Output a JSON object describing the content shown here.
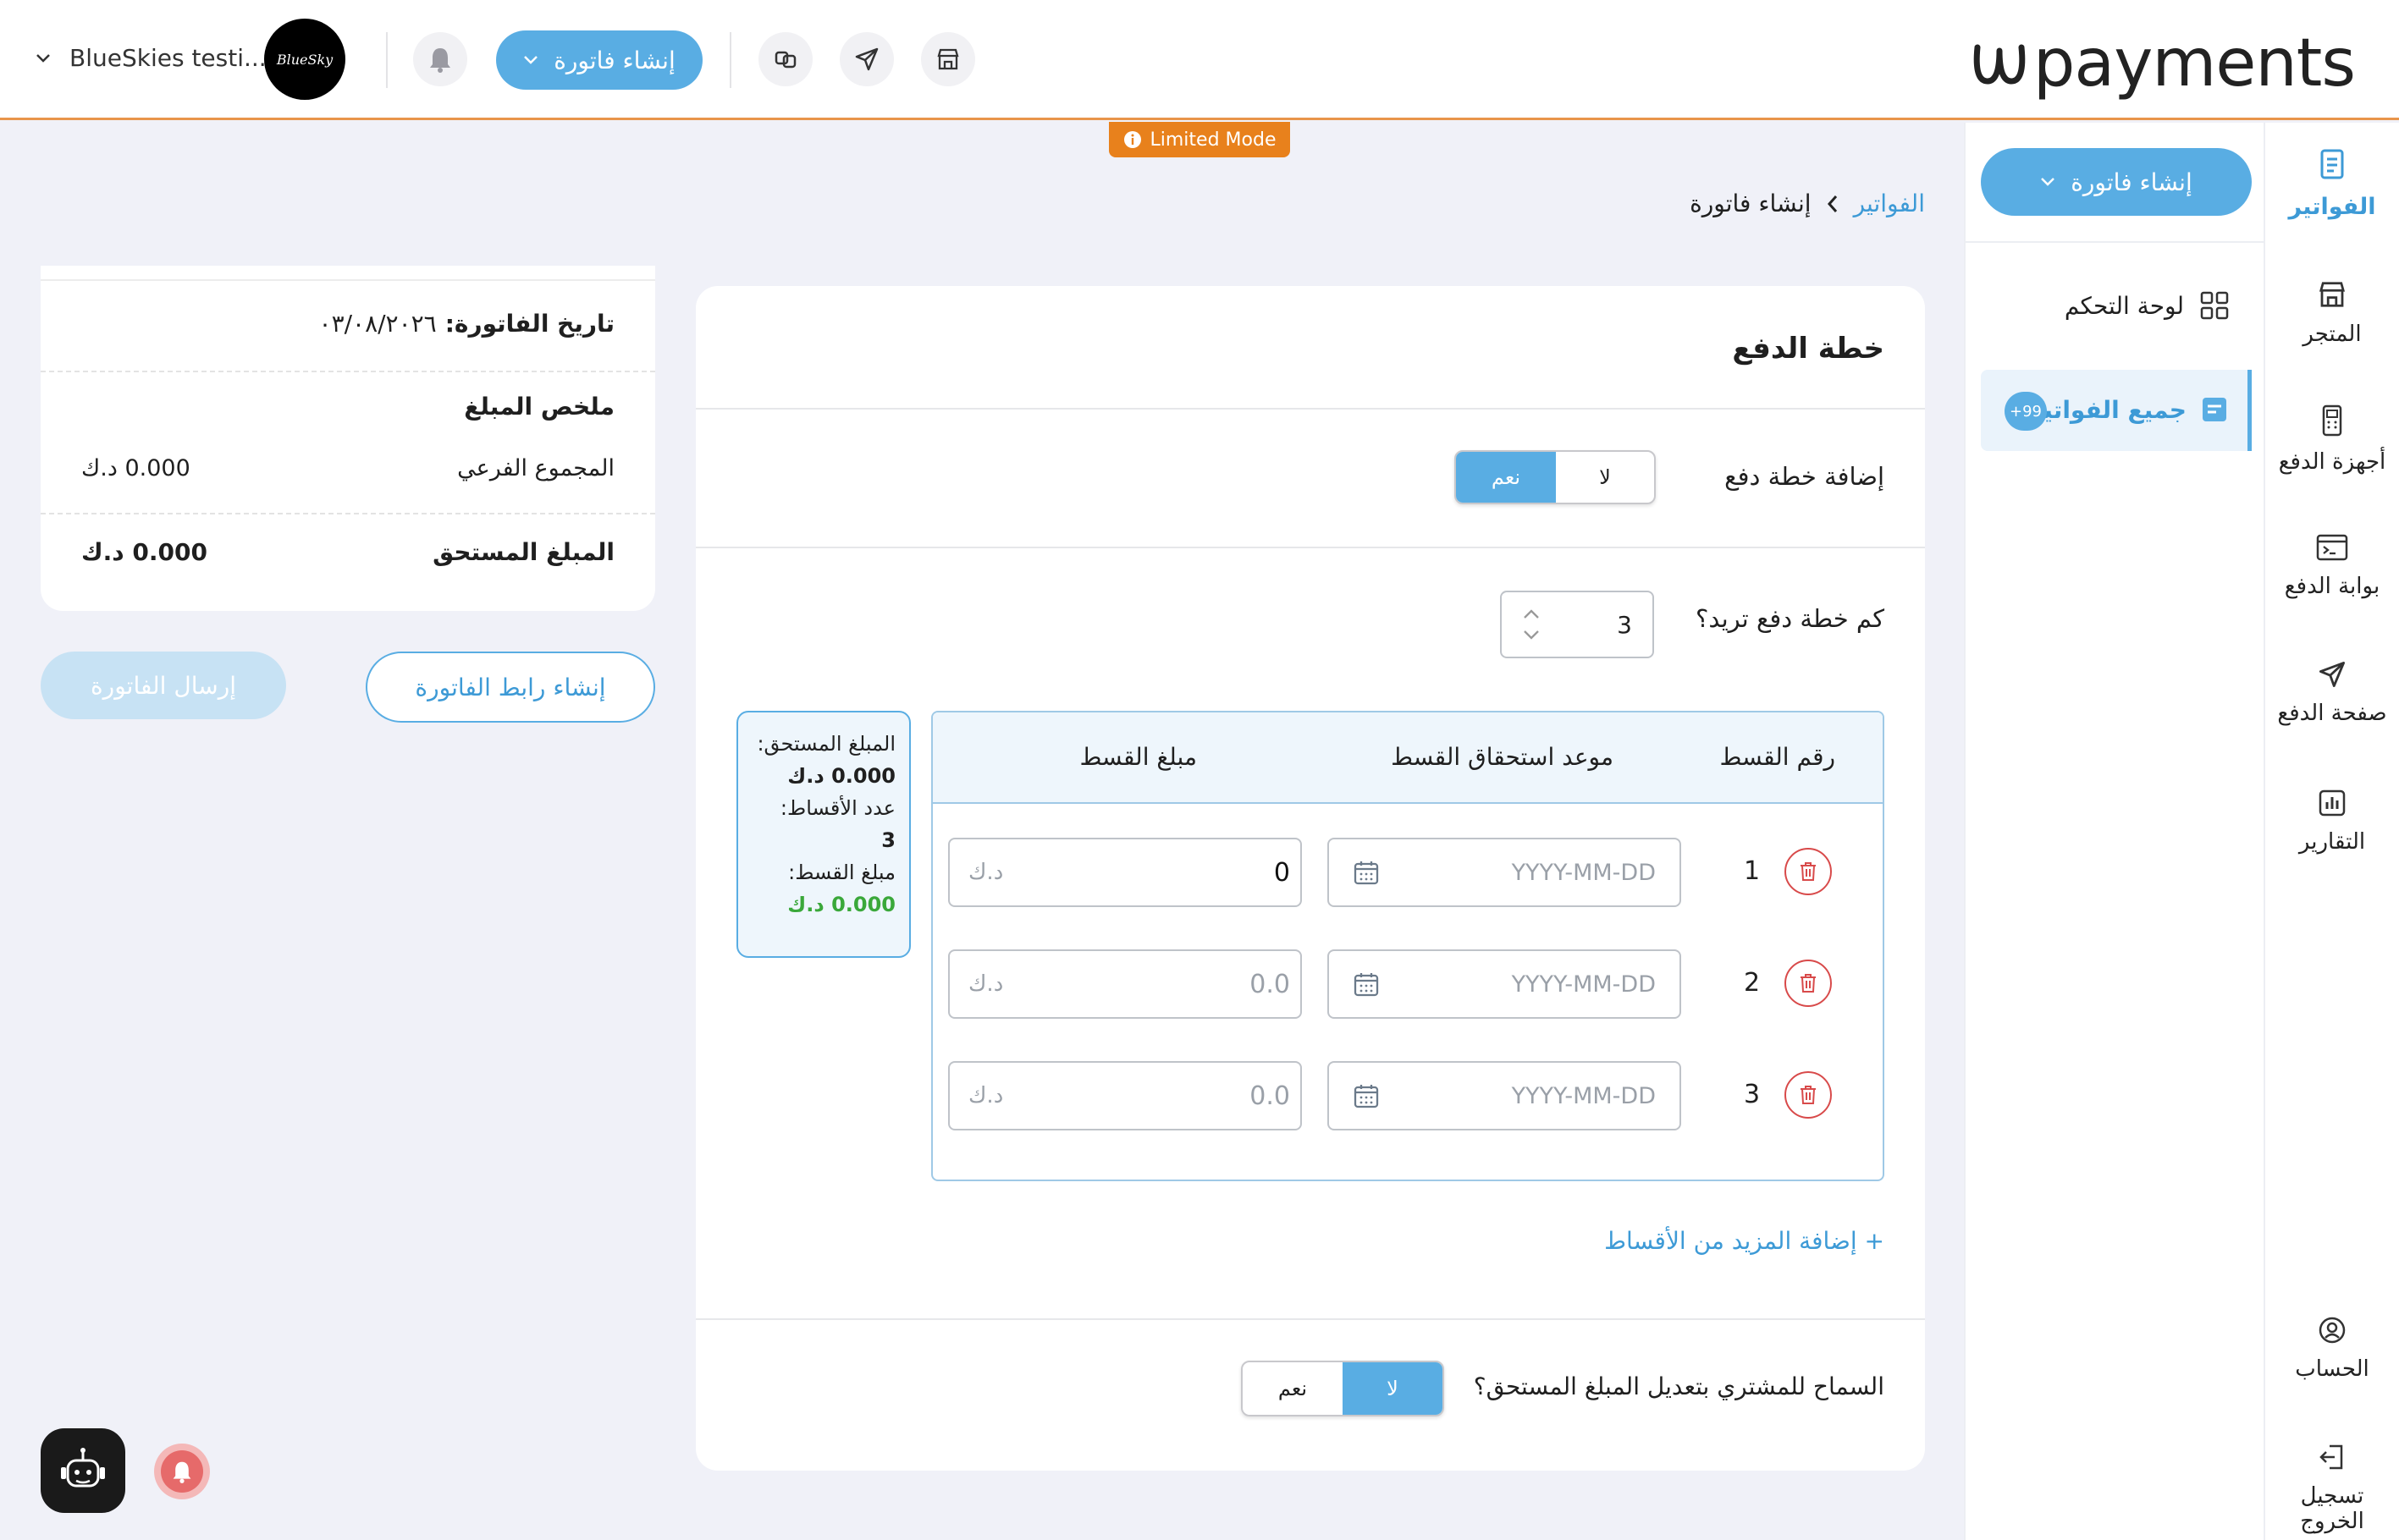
{
  "header": {
    "logo_text": "payments",
    "account_name": "BlueSkies testi...",
    "avatar_text": "BlueSky",
    "create_invoice_btn": "إنشاء فاتورة"
  },
  "limited_mode": "Limited Mode",
  "rail": {
    "items": [
      {
        "label": "الفواتير",
        "icon": "invoice-icon",
        "active": true
      },
      {
        "label": "المتجر",
        "icon": "store-icon"
      },
      {
        "label": "أجهزة الدفع",
        "icon": "pos-device-icon"
      },
      {
        "label": "بوابة الدفع",
        "icon": "gateway-icon"
      },
      {
        "label": "صفحة الدفع",
        "icon": "send-icon"
      },
      {
        "label": "التقارير",
        "icon": "reports-icon"
      }
    ],
    "account": "الحساب",
    "logout": "تسجيل الخروج"
  },
  "sidepanel": {
    "create_btn": "إنشاء فاتورة",
    "dashboard": "لوحة التحكم",
    "all_invoices": "جميع الفواتير",
    "badge": "+99"
  },
  "breadcrumb": {
    "parent": "الفواتير",
    "current": "إنشاء فاتورة"
  },
  "payment_plan": {
    "title": "خطة الدفع",
    "add_plan_label": "إضافة خطة دفع",
    "no": "لا",
    "yes": "نعم",
    "count_label": "كم خطة دفع تريد؟",
    "count_value": "3",
    "columns": [
      "رقم القسط",
      "موعد استحقاق القسط",
      "مبلغ القسط"
    ],
    "rows": [
      {
        "num": "1",
        "date_placeholder": "YYYY-MM-DD",
        "amount": "0",
        "currency": "د.ك",
        "amount_filled": true
      },
      {
        "num": "2",
        "date_placeholder": "YYYY-MM-DD",
        "amount": "0.0",
        "currency": "د.ك",
        "amount_filled": false
      },
      {
        "num": "3",
        "date_placeholder": "YYYY-MM-DD",
        "amount": "0.0",
        "currency": "د.ك",
        "amount_filled": false
      }
    ],
    "add_more": "+ إضافة المزيد من الأقساط",
    "allow_edit_label": "السماح للمشتري بتعديل المبلغ المستحق؟",
    "summary": {
      "due_label": "المبلغ المستحق:",
      "due_value": "0.000 د.ك",
      "count_label": "عدد الأقساط:",
      "count_value": "3",
      "installment_label": "مبلغ القسط:",
      "installment_value": "0.000 د.ك"
    }
  },
  "invoice_summary": {
    "date_label": "تاريخ الفاتورة:",
    "date_value": "٠٣/٠٨/٢٠٢٦",
    "summary_title": "ملخص المبلغ",
    "subtotal_label": "المجموع الفرعي",
    "subtotal_value": "0.000 د.ك",
    "due_label": "المبلغ المستحق",
    "due_value": "0.000 د.ك"
  },
  "actions": {
    "create_link": "إنشاء رابط الفاتورة",
    "send_invoice": "إرسال الفاتورة"
  },
  "colors": {
    "accent": "#59ade3",
    "warning": "#e8811c",
    "danger": "#d84a4a",
    "success": "#3aa83a"
  }
}
